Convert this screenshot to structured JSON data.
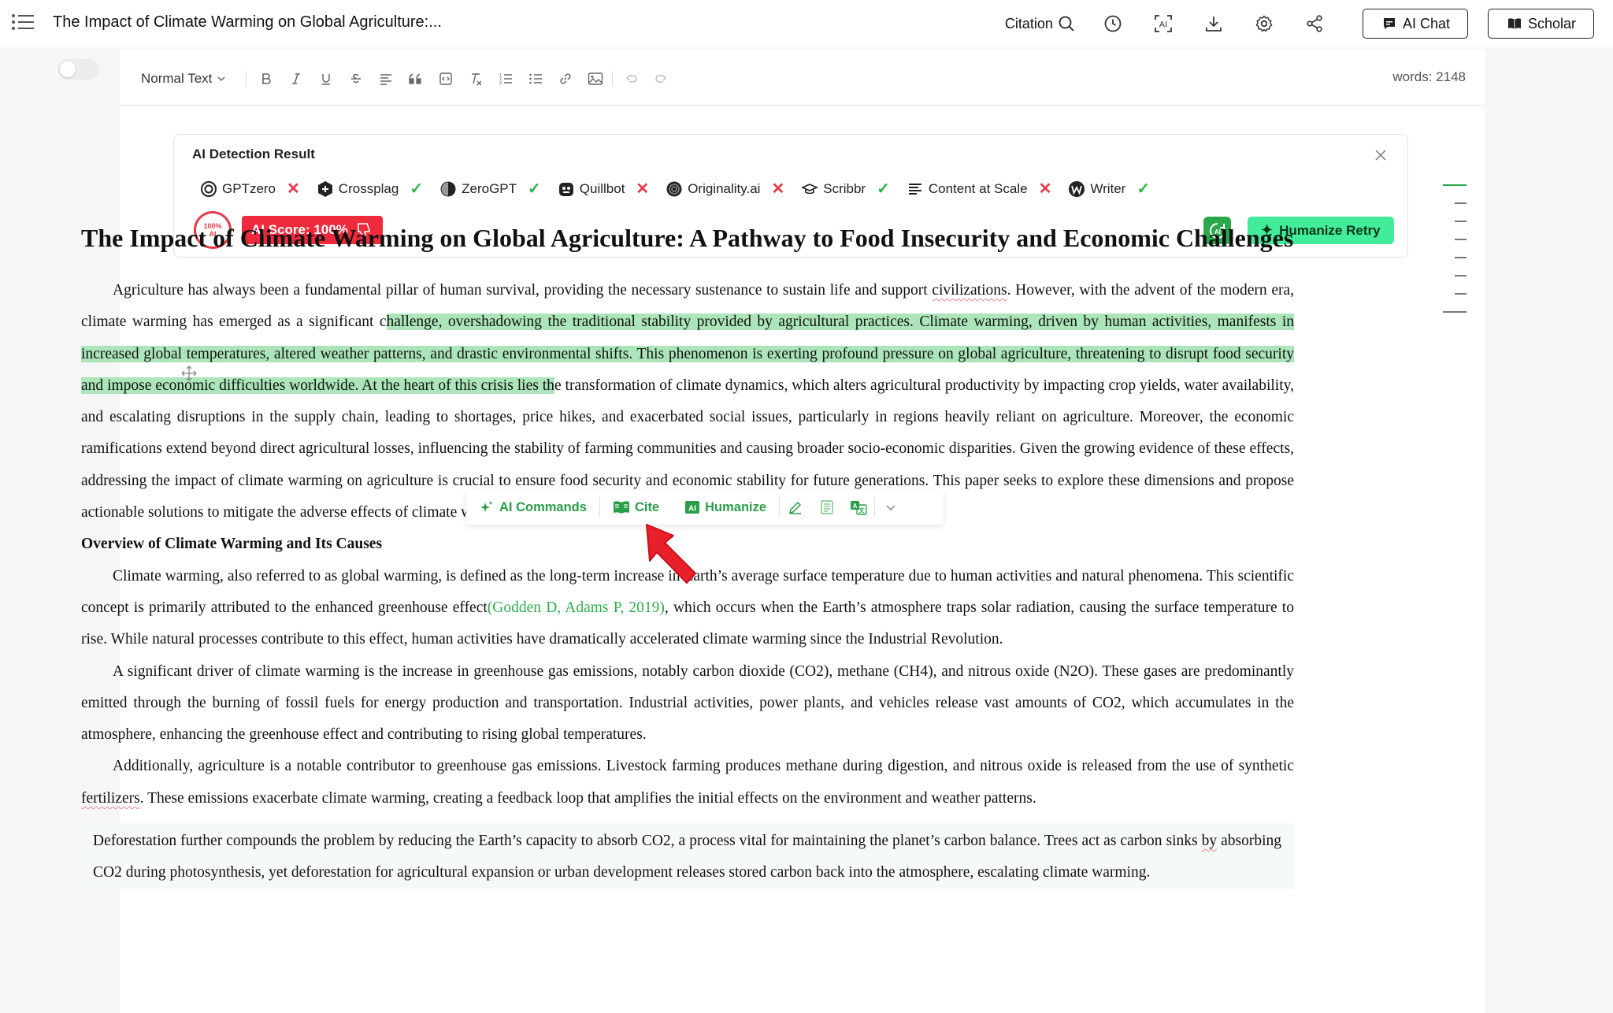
{
  "app": {
    "doc_title": "The Impact of Climate Warming on Global Agriculture:...",
    "citation_label": "Citation",
    "ai_chat_label": "AI Chat",
    "scholar_label": "Scholar"
  },
  "toolbar": {
    "text_style": "Normal Text",
    "words_label": "words: 2148"
  },
  "detection": {
    "title": "AI Detection Result",
    "detectors": [
      {
        "name": "GPTzero",
        "result": "fail"
      },
      {
        "name": "Crossplag",
        "result": "pass"
      },
      {
        "name": "ZeroGPT",
        "result": "pass"
      },
      {
        "name": "Quillbot",
        "result": "fail"
      },
      {
        "name": "Originality.ai",
        "result": "fail"
      },
      {
        "name": "Scribbr",
        "result": "pass"
      },
      {
        "name": "Content at Scale",
        "result": "fail"
      },
      {
        "name": "Writer",
        "result": "pass"
      }
    ],
    "ring_top": "100%",
    "ring_bottom": "AI",
    "score_label": "AI Score: 100%",
    "humanize_retry_label": "Humanize Retry",
    "colors": {
      "pass": "#2fb344",
      "fail": "#e8394a",
      "score": "#ef2a3c",
      "retry": "#42ec9a"
    }
  },
  "document": {
    "title": "The Impact of Climate Warming on Global Agriculture: A Pathway to Food Insecurity and Economic Challenges",
    "p1": {
      "a": "Agriculture has always been a fundamental pillar of human survival, providing the necessary sustenance to sustain life and support ",
      "b": "civilizations",
      "c": ". However, with the advent of the modern era, climate warming has emerged as a significant c",
      "hl": "hallenge, overshadowing the traditional stability provided by agricultural practices. Climate warming, driven by human activities, manifests in increased global temperatures, altered weather patterns, and drastic environmental shifts. This phenomenon is exerting profound pressure on global agriculture, threatening to disrupt food security and impose economic difficulties worldwide. At the heart of this crisis lies th",
      "d": "e transformation of climate dynamics, which alters agricultural productivity by impacting crop yields, water availability, and escalating disruptions in the supply chain, leading to shortages, price hikes, and exacerbated social issues, particularly in regions heavily reliant on agriculture. Moreover, the economic ramifications extend beyond direct agricultural losses, influencing the stability of farming communities and causing broader socio-economic disparities. Given the growing evidence of these effects, addressing the impact of climate warming on agriculture is crucial to ensure food security and economic stability for future generations. This paper seeks to explore these dimensions and propose actionable solutions to mitigate the adverse effects of climate warming on global agriculture."
    },
    "h2": "Overview of Climate Warming and Its Causes",
    "p2": {
      "a": "Climate warming, also referred to as global warming, is defined as the long-term increase in Earth’s average surface temperature due to human activities and natural phenomena. This scientific concept is primarily attributed to the enhanced greenhouse effect",
      "cite": "(Godden D, Adams P, 2019)",
      "b": ", which occurs when the Earth’s atmosphere traps solar radiation, causing the surface temperature to rise. While natural processes contribute to this effect, human activities have dramatically accelerated climate warming since the Industrial Revolution."
    },
    "p3": "A significant driver of climate warming is the increase in greenhouse gas emissions, notably carbon dioxide (CO2), methane (CH4), and nitrous oxide (N2O). These gases are predominantly emitted through the burning of fossil fuels for energy production and transportation. Industrial activities, power plants, and vehicles release vast amounts of CO2, which accumulates in the atmosphere, enhancing the greenhouse effect and contributing to rising global temperatures.",
    "p4": {
      "a": "Additionally, agriculture is a notable contributor to greenhouse gas emissions. Livestock farming produces methane during digestion, and nitrous oxide is released from the use of synthetic ",
      "b": "fertilizers",
      "c": ". These emissions exacerbate climate warming, creating a feedback loop that amplifies the initial effects on the environment and weather patterns."
    },
    "p5": {
      "a": "Deforestation further compounds the problem by reducing the Earth’s capacity to absorb CO2, a process vital for maintaining the planet’s carbon balance. Trees act as carbon sinks ",
      "b": "by",
      "c": " absorbing CO2 during photosynthesis, yet deforestation for agricultural expansion or urban development releases stored carbon back into the atmosphere, escalating climate warming."
    }
  },
  "float_toolbar": {
    "ai_commands": "AI Commands",
    "cite": "Cite",
    "humanize": "Humanize"
  }
}
